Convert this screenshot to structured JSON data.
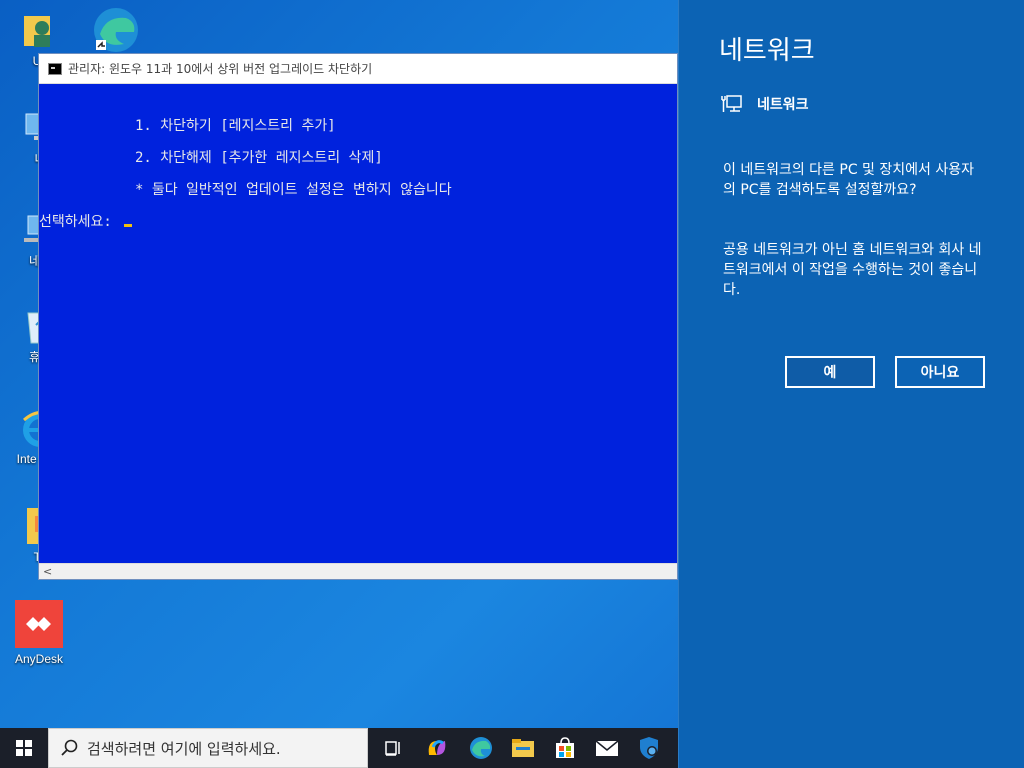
{
  "desktop": {
    "icons": [
      {
        "label": "Us",
        "name": "user-folder-icon"
      },
      {
        "label": "",
        "name": "edge-desktop-icon"
      },
      {
        "label": "내",
        "name": "my-pc-icon"
      },
      {
        "label": "네트",
        "name": "network-desktop-icon"
      },
      {
        "label": "휴지",
        "name": "recycle-bin-icon"
      },
      {
        "label": "Inte Expl",
        "name": "internet-explorer-icon"
      },
      {
        "label": "To",
        "name": "to-folder-icon"
      },
      {
        "label": "AnyDesk",
        "name": "anydesk-icon"
      }
    ]
  },
  "console": {
    "title": "관리자:  윈도우 11과 10에서 상위 버전 업그레이드 차단하기",
    "lines": [
      "1. 차단하기 [레지스트리 추가]",
      "2. 차단해제 [추가한 레지스트리 삭제]",
      "* 둘다 일반적인 업데이트 설정은 변하지 않습니다",
      "선택하세요: "
    ],
    "scroll_left": "<"
  },
  "flyout": {
    "title": "네트워크",
    "network_name": "네트워크",
    "question": "이 네트워크의 다른 PC 및 장치에서 사용자의 PC를 검색하도록 설정할까요?",
    "advice": "공용 네트워크가 아닌 홈 네트워크와 회사 네트워크에서 이 작업을 수행하는 것이 좋습니다.",
    "yes_label": "예",
    "no_label": "아니요"
  },
  "taskbar": {
    "search_placeholder": "검색하려면 여기에 입력하세요."
  },
  "colors": {
    "console_bg": "#0022dd",
    "flyout_bg": "#0c63b4",
    "taskbar_bg": "#1b1f29",
    "anydesk": "#ef443b"
  }
}
